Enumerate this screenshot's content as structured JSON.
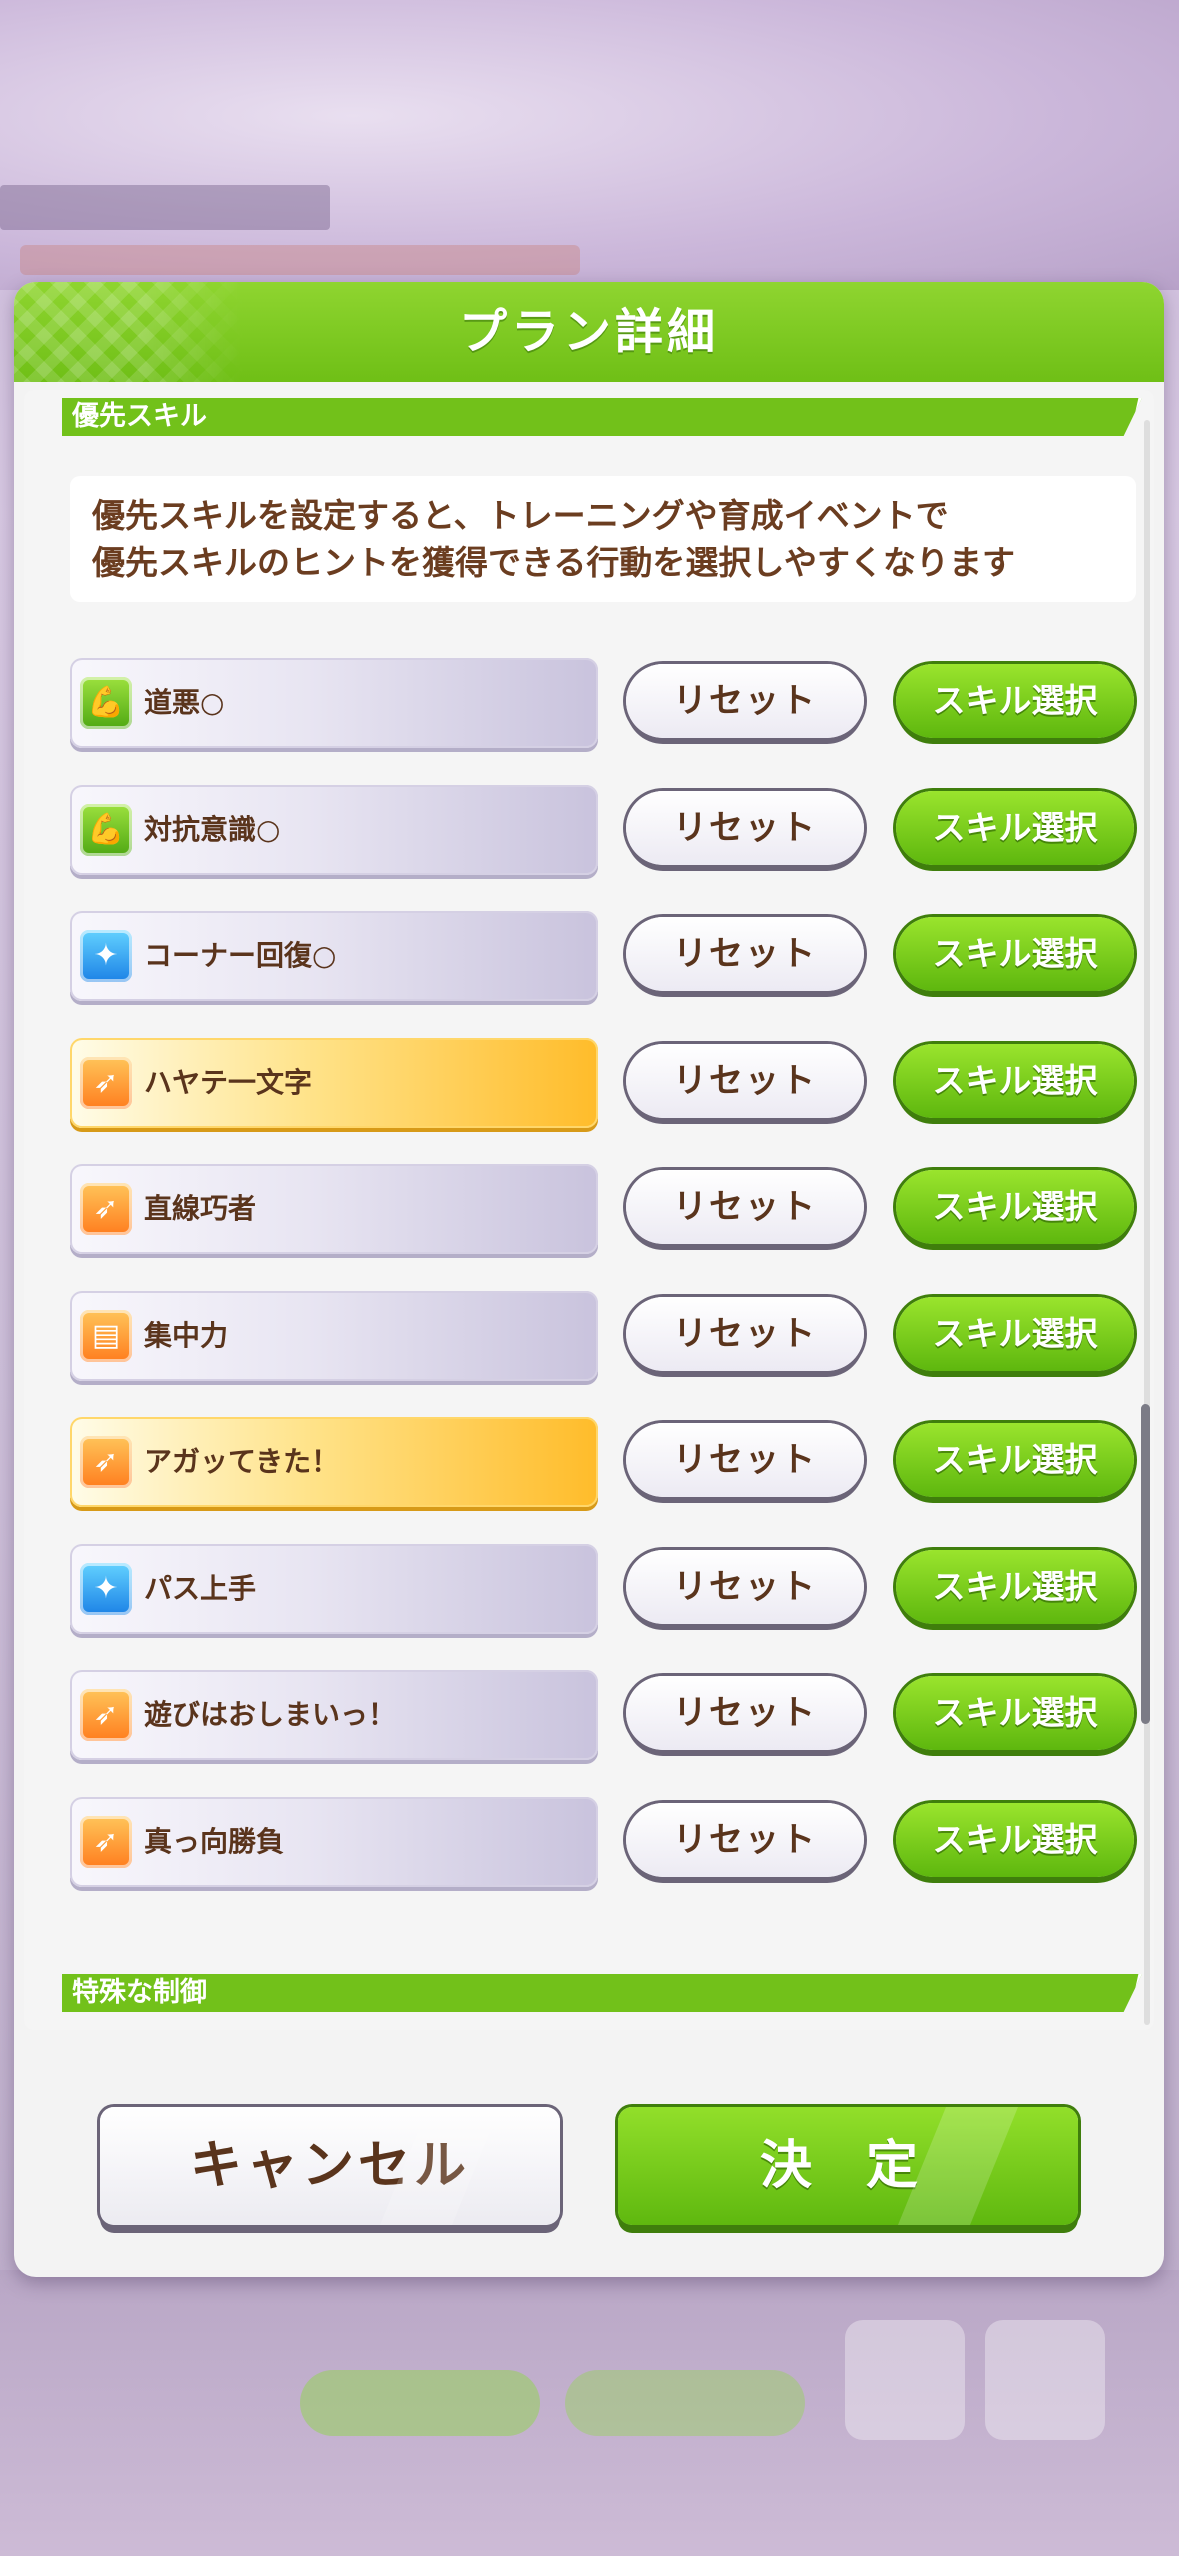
{
  "dialog": {
    "title": "プラン詳細"
  },
  "sections": {
    "priority_label": "優先スキル",
    "special_label": "特殊な制御"
  },
  "description": {
    "line1": "優先スキルを設定すると、トレーニングや育成イベントで",
    "line2": "優先スキルのヒントを獲得できる行動を選択しやすくなります"
  },
  "skills": [
    {
      "name": "道悪○",
      "icon": "muscle-icon",
      "style": "normal"
    },
    {
      "name": "対抗意識○",
      "icon": "muscle-icon",
      "style": "normal"
    },
    {
      "name": "コーナー回復○",
      "icon": "sparkle-icon",
      "style": "normal"
    },
    {
      "name": "ハヤテ一文字",
      "icon": "runner-icon",
      "style": "gold"
    },
    {
      "name": "直線巧者",
      "icon": "runner-icon",
      "style": "normal"
    },
    {
      "name": "集中力",
      "icon": "gate-icon",
      "style": "normal"
    },
    {
      "name": "アガッてきた！",
      "icon": "runner-icon",
      "style": "gold"
    },
    {
      "name": "パス上手",
      "icon": "sparkle-icon",
      "style": "normal"
    },
    {
      "name": "遊びはおしまいっ！",
      "icon": "runner-icon",
      "style": "normal"
    },
    {
      "name": "真っ向勝負",
      "icon": "runner-icon",
      "style": "normal"
    }
  ],
  "buttons": {
    "reset": "リセット",
    "select_skill": "スキル選択",
    "cancel": "キャンセル",
    "confirm": "決 定"
  },
  "colors": {
    "accent_green": "#72c11a",
    "text_brown": "#5a341c",
    "gold": "#ffbc2a"
  }
}
